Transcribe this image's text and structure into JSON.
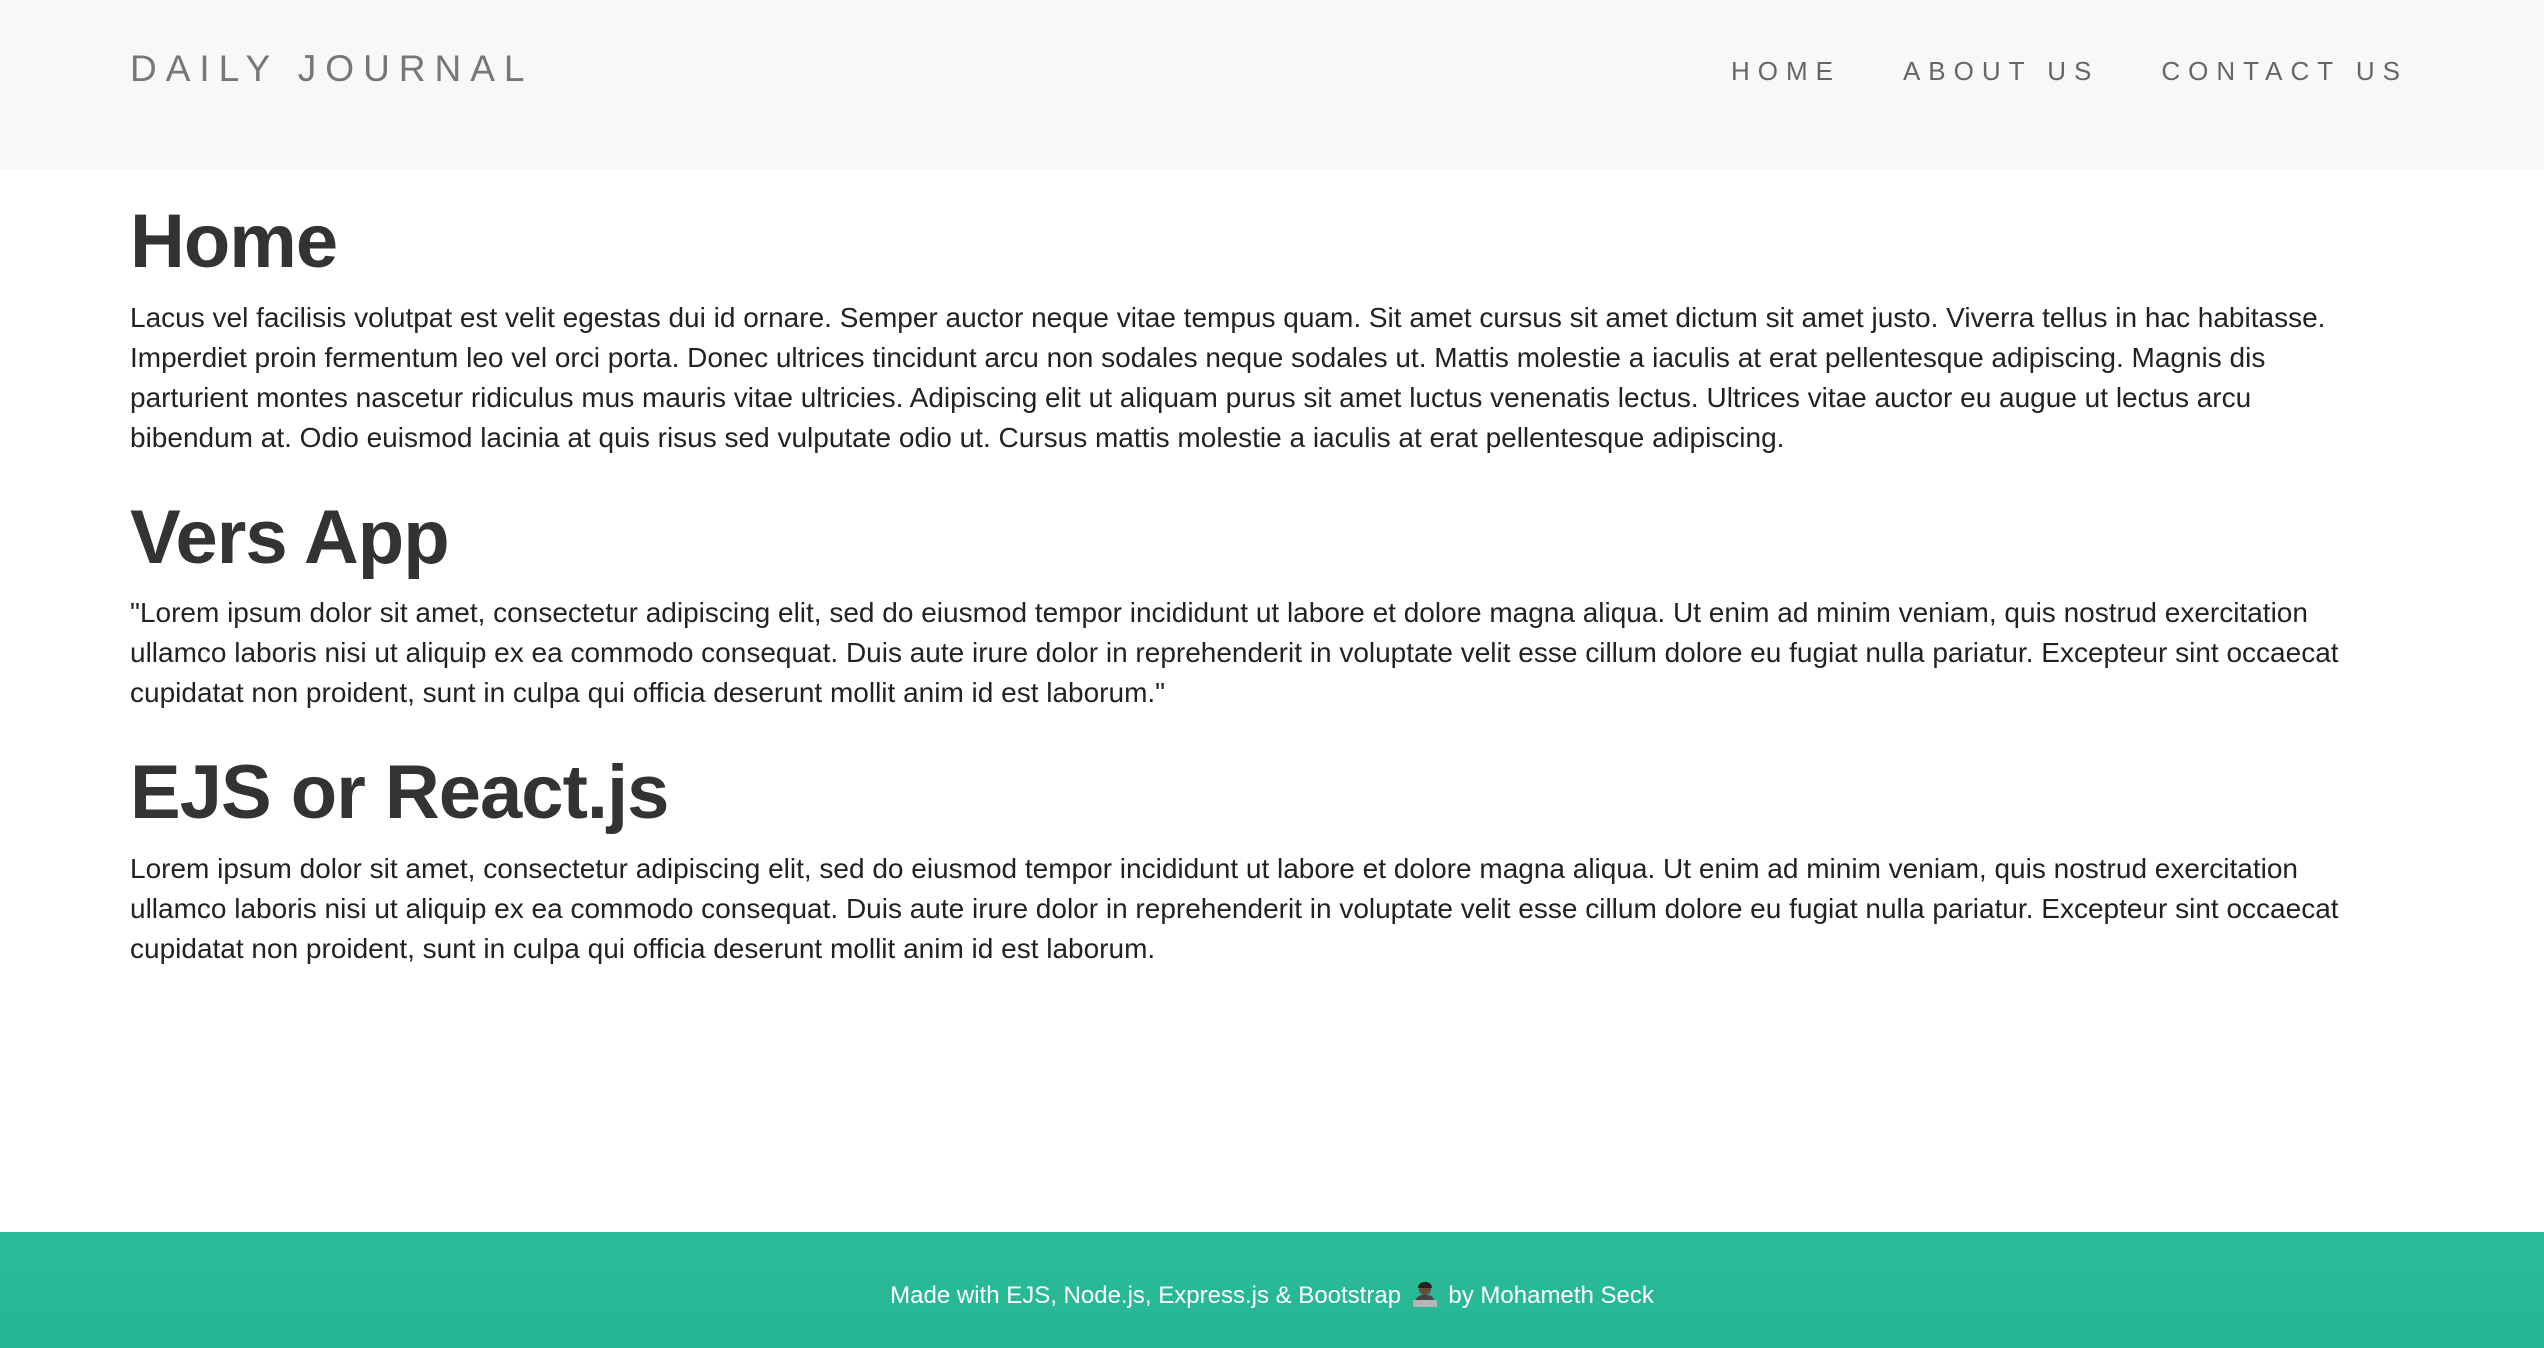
{
  "header": {
    "brand": "DAILY JOURNAL",
    "nav": [
      {
        "label": "HOME"
      },
      {
        "label": "ABOUT US"
      },
      {
        "label": "CONTACT US"
      }
    ]
  },
  "posts": [
    {
      "title": "Home",
      "body": "Lacus vel facilisis volutpat est velit egestas dui id ornare. Semper auctor neque vitae tempus quam. Sit amet cursus sit amet dictum sit amet justo. Viverra tellus in hac habitasse. Imperdiet proin fermentum leo vel orci porta. Donec ultrices tincidunt arcu non sodales neque sodales ut. Mattis molestie a iaculis at erat pellentesque adipiscing. Magnis dis parturient montes nascetur ridiculus mus mauris vitae ultricies. Adipiscing elit ut aliquam purus sit amet luctus venenatis lectus. Ultrices vitae auctor eu augue ut lectus arcu bibendum at. Odio euismod lacinia at quis risus sed vulputate odio ut. Cursus mattis molestie a iaculis at erat pellentesque adipiscing."
    },
    {
      "title": "Vers App",
      "body": "\"Lorem ipsum dolor sit amet, consectetur adipiscing elit, sed do eiusmod tempor incididunt ut labore et dolore magna aliqua. Ut enim ad minim veniam, quis nostrud exercitation ullamco laboris nisi ut aliquip ex ea commodo consequat. Duis aute irure dolor in reprehenderit in voluptate velit esse cillum dolore eu fugiat nulla pariatur. Excepteur sint occaecat cupidatat non proident, sunt in culpa qui officia deserunt mollit anim id est laborum.\""
    },
    {
      "title": "EJS or React.js",
      "body": "Lorem ipsum dolor sit amet, consectetur adipiscing elit, sed do eiusmod tempor incididunt ut labore et dolore magna aliqua. Ut enim ad minim veniam, quis nostrud exercitation ullamco laboris nisi ut aliquip ex ea commodo consequat. Duis aute irure dolor in reprehenderit in voluptate velit esse cillum dolore eu fugiat nulla pariatur. Excepteur sint occaecat cupidatat non proident, sunt in culpa qui officia deserunt mollit anim id est laborum."
    }
  ],
  "footer": {
    "text_before": "Made with EJS, Node.js, Express.js & Bootstrap",
    "icon": "developer-emoji-icon",
    "text_after": "by Mohameth Seck",
    "background_color": "#2bbc9b"
  },
  "colors": {
    "navbar_background": "#f8f8f8",
    "brand_text": "#777777",
    "heading_text": "#333333",
    "footer_background": "#2bbc9b"
  }
}
